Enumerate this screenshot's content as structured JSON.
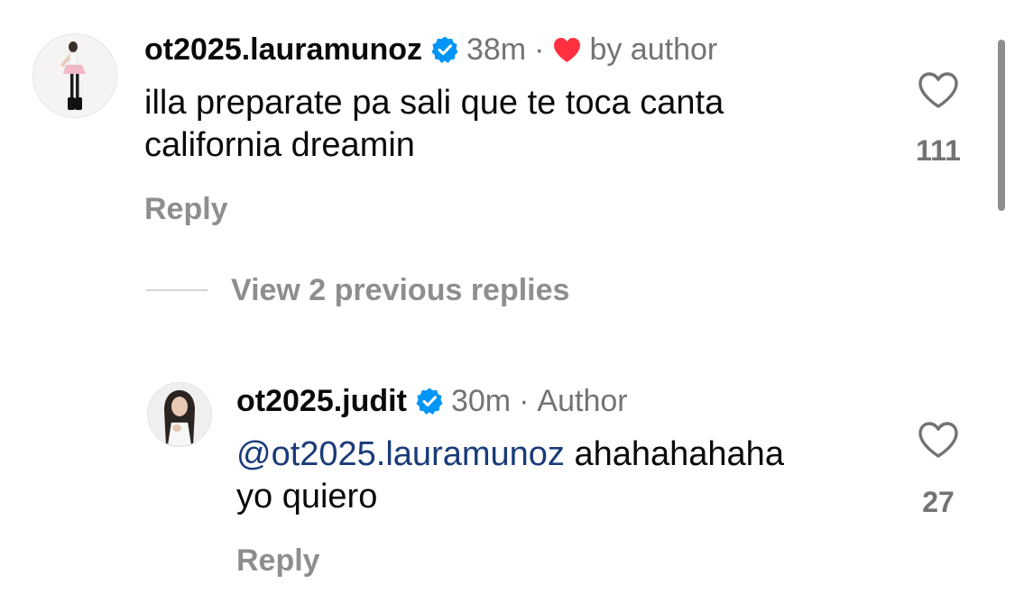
{
  "comment": {
    "username": "ot2025.lauramunoz",
    "time": "38m",
    "separator": "·",
    "byline": "by author",
    "text_line1": "illa preparate pa sali que te toca canta",
    "text_line2": "california dreamin",
    "reply_label": "Reply",
    "like_count": "111",
    "liked_by_author": true
  },
  "view_replies": {
    "label": "View 2 previous replies"
  },
  "reply": {
    "username": "ot2025.judit",
    "time": "30m",
    "separator": "·",
    "byline": "Author",
    "mention": "@ot2025.lauramunoz",
    "text_rest": " ahahahahaha",
    "text_line2": "yo quiero",
    "reply_label": "Reply",
    "like_count": "27"
  },
  "colors": {
    "verified_blue": "#0095f6",
    "heart_red": "#ff3040",
    "mention_blue": "#1a3b7a",
    "secondary_text": "#737373"
  },
  "icons": {
    "verified": "verified-badge-icon",
    "author_heart": "heart-filled-icon",
    "like": "heart-outline-icon"
  }
}
